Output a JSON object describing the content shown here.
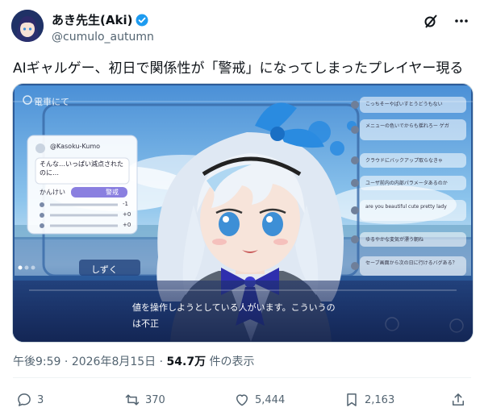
{
  "author": {
    "display_name": "あき先生(Aki)",
    "handle": "@cumulo_autumn"
  },
  "post": {
    "text": "AIギャルゲー、初日で関係性が「警戒」になってしまったプレイヤー現る"
  },
  "media": {
    "scene_label": "電車にて",
    "profile_name": "@Kasoku-Kumo",
    "quote_text_1": "そんな…いっぱい減点された",
    "quote_text_2": "のに…",
    "relation_label": "かんけい",
    "relation_value": "警戒",
    "stats": [
      "-1",
      "+0",
      "+0"
    ],
    "speaker": "しずく",
    "dialogue_1": "値を操作しようとしている人がいます。こういうの",
    "dialogue_2": "は不正",
    "chat": [
      "こっちそーやぱいすとうどうもない",
      "メニューの色いでからも揺れろー ゲガ",
      "クラウドにバックアップ取らなきゃ",
      "ユーザ前内の内部パラメータあるのか",
      "are you beautiful cute pretty lady",
      "ゆるやかな変気が漂う朝ね",
      "セーブ画面から次の日に行けるバグある？"
    ]
  },
  "meta": {
    "time": "午後9:59",
    "date": "2026年8月15日",
    "views_count": "54.7万",
    "views_label": "件の表示"
  },
  "actions": {
    "replies": "3",
    "reposts": "370",
    "likes": "5,444",
    "bookmarks": "2,163"
  },
  "colors": {
    "accent": "#1d9bf0",
    "muted": "#536471",
    "relation_badge": "#8a7fe0"
  }
}
